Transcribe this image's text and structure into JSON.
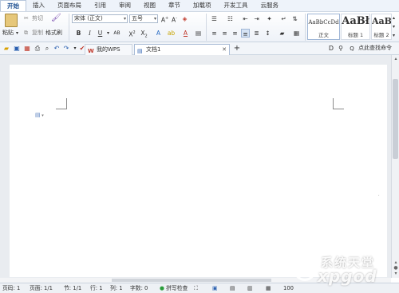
{
  "menu": {
    "tabs": [
      "开始",
      "插入",
      "页面布局",
      "引用",
      "审阅",
      "视图",
      "章节",
      "加载项",
      "开发工具",
      "云服务"
    ],
    "active": "开始"
  },
  "ribbon": {
    "paste_label": "粘贴",
    "cut_label": "剪切",
    "copy_label": "复制",
    "format_painter_label": "格式刷",
    "font_name": "宋体 (正文)",
    "font_size": "五号",
    "styles": [
      {
        "sample": "AaBbCcDd",
        "name": "正文"
      },
      {
        "sample": "AaBł",
        "name": "标题 1"
      },
      {
        "sample": "AaB",
        "name": "标题 2"
      }
    ]
  },
  "tabsbar": {
    "doc_tabs": [
      {
        "label": "我的WPS"
      },
      {
        "label": "文档1"
      }
    ],
    "search_text": "点此查找命令"
  },
  "statusbar": {
    "page": "页码: 1",
    "pages": "页面: 1/1",
    "section": "节: 1/1",
    "row": "行: 1",
    "col": "列: 1",
    "words": "字数: 0",
    "spellcheck": "拼写检查",
    "zoom": "100"
  },
  "watermark": {
    "cn": "系统天堂",
    "en": "xpgod"
  }
}
